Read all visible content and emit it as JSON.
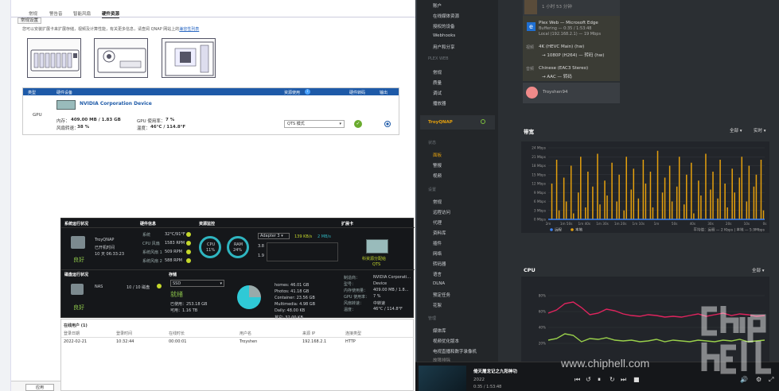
{
  "qnap": {
    "tabs": [
      "常规",
      "警告音",
      "智能风扇",
      "硬件资源"
    ],
    "active_tab": "硬件资源",
    "subtab": "常规设置",
    "description": "您可以安装扩展卡来扩展存储，视频及计算性能，有关更多信息，请查阅 QNAP 网站上的",
    "description_link": "兼容性列表",
    "gpu_table": {
      "headers": [
        "类型",
        "硬件设备",
        "资源使用",
        "硬件转码",
        "输出"
      ],
      "row": {
        "type": "GPU",
        "device_name": "NVIDIA Corporation Device",
        "memory_label": "内存：",
        "memory_value": "409.00 MB / 1.83 GB",
        "gpu_usage_label": "GPU 使用率：",
        "gpu_usage_value": "7 %",
        "fan_label": "风扇转速：",
        "fan_value": "38 %",
        "temp_label": "温度：",
        "temp_value": "46°C / 114.8°F",
        "mode": "QTS 模式"
      }
    },
    "apply_label": "应用"
  },
  "widget": {
    "titles": [
      "系统运行状况",
      "硬件信息",
      "资源监控",
      "扩展卡"
    ],
    "system": {
      "name": "TroyQNAP",
      "uptime_label": "已开机时间",
      "uptime": "10 天 06:33:23",
      "status": "良好"
    },
    "hardware": [
      {
        "label": "系统",
        "value": "32°C/91°F"
      },
      {
        "label": "CPU 风扇",
        "value": "1583 RPM"
      },
      {
        "label": "系统风扇 1",
        "value": "509 RPM"
      },
      {
        "label": "系统风扇 2",
        "value": "588 RPM"
      }
    ],
    "resources": {
      "cpu_label": "CPU",
      "cpu_value": "11%",
      "ram_label": "RAM",
      "ram_value": "24%",
      "adapter": "Adapter 3",
      "rx": "139 KB/s",
      "tx": "2 MB/s",
      "scale": [
        "3.8",
        "1.9"
      ]
    },
    "card": {
      "label": "科资源分配给",
      "label2": "QTS"
    },
    "disk": {
      "title": "磁盘运行状况",
      "label": "NAS",
      "value": "10 / 10 磁盘",
      "status": "良好"
    },
    "storage": {
      "title": "存储",
      "select": "SSD",
      "status": "就绪",
      "used": "已使用：253.18 GB",
      "free": "可用：1.16 TB",
      "folders": [
        "homes: 46.01 GB",
        "Photos: 41.18 GB",
        "Container: 23.56 GB",
        "Multimedia: 4.98 GB",
        "Daily: 48.00 KB",
        "其它: 32.00 KB"
      ]
    },
    "card_info": [
      {
        "label": "制造商：",
        "value": "NVIDIA Corporati..."
      },
      {
        "label": "型号：",
        "value": "Device"
      },
      {
        "label": "内存使用量：",
        "value": "409.00 MB / 1.8..."
      },
      {
        "label": "GPU 使用率：",
        "value": "7 %"
      },
      {
        "label": "风扇转速：",
        "value": "中转速"
      },
      {
        "label": "温度：",
        "value": "46°C / 114.8°F"
      }
    ]
  },
  "users": {
    "title": "在线用户 (1)",
    "headers": [
      "登录日期",
      "登录时间",
      "在线时长",
      "用户名",
      "来源 IP",
      "连接类型"
    ],
    "row": [
      "2022-02-21",
      "10:32:44",
      "00:00:01",
      "Troyshen",
      "192.168.2.1",
      "HTTP"
    ]
  },
  "plex": {
    "sidebar_top": [
      "账户",
      "在线媒体资源",
      "授权的设备",
      "Webhooks",
      "用户和分享"
    ],
    "plex_web_label": "PLEX WEB",
    "plex_web_items": [
      "常规",
      "质量",
      "调试",
      "播放器"
    ],
    "server": "TroyQNAP",
    "status_label": "状态",
    "status_items": [
      "面板",
      "警报",
      "视频"
    ],
    "settings_label": "设置",
    "settings_items": [
      "常规",
      "远程访问",
      "代理",
      "资料库",
      "插件",
      "网络",
      "转码器",
      "语言",
      "DLNA",
      "预定任务",
      "花絮"
    ],
    "manage_label": "管理",
    "manage_items": [
      "媒体库",
      "视频优化版本",
      "电视直播和数字录像机",
      "故障排除"
    ],
    "session": {
      "uptime": "1 小时 53 分钟",
      "client": "Plex Web — Microsoft Edge",
      "buffering": "Buffering — 0:35 / 1:53:48",
      "location": "Local (192.168.2.1) — 19 Mbps",
      "video_label": "视频",
      "video_src": "4K (HEVC Main) (hw)",
      "video_dst": "→ 1080P (H264) — 转码 (hw)",
      "audio_label": "音频",
      "audio_src": "Chinese (EAC3 Stereo)",
      "audio_dst": "→ AAC — 转码",
      "user": "Troyshen94"
    },
    "bandwidth": {
      "title": "带宽",
      "filter": "全部 ▾",
      "mode": "实时 ▾",
      "legend_local": "远程",
      "legend_remote": "本地",
      "summary": "平均值：远程 — 2 Kbps | 本地 — 5.9Mbps"
    },
    "cpu": {
      "title": "CPU",
      "filter": "全部 ▾"
    }
  },
  "chart_data": [
    {
      "type": "bar",
      "title": "带宽",
      "ylabel": "",
      "yticks": [
        "0 Mbps",
        "3 Mbps",
        "6 Mbps",
        "9 Mbps",
        "12 Mbps",
        "15 Mbps",
        "18 Mbps",
        "21 Mbps",
        "24 Mbps"
      ],
      "xticks": [
        "2m",
        "1m 50s",
        "1m 40s",
        "1m 30s",
        "1m 20s",
        "1m 10s",
        "1m",
        "50s",
        "40s",
        "30s",
        "20s",
        "10s",
        "0s"
      ],
      "ylim": [
        0,
        24
      ],
      "series": [
        {
          "name": "本地",
          "color": "#e5a00d",
          "values": [
            0,
            12,
            0,
            20,
            3,
            0,
            14,
            6,
            0,
            18,
            2,
            0,
            9,
            21,
            0,
            4,
            16,
            0,
            11,
            0,
            22,
            5,
            0,
            13,
            8,
            0,
            19,
            0,
            6,
            15,
            0,
            3,
            21,
            0,
            10,
            17,
            0,
            7,
            0,
            20,
            12,
            0,
            16,
            4,
            0,
            23,
            0,
            9,
            14,
            0,
            18,
            6,
            0,
            11,
            21,
            0,
            5,
            15,
            0,
            19,
            2,
            0,
            13,
            8,
            0,
            22,
            0,
            10,
            16,
            0,
            7,
            20,
            0,
            12,
            4,
            0,
            17,
            9,
            0,
            14,
            21,
            0,
            6,
            18,
            0,
            11,
            15,
            0,
            20,
            3
          ]
        },
        {
          "name": "远程",
          "color": "#3b82f6",
          "values": []
        }
      ]
    },
    {
      "type": "line",
      "title": "CPU",
      "yticks": [
        "20%",
        "40%",
        "60%",
        "80%"
      ],
      "ylim": [
        0,
        100
      ],
      "series": [
        {
          "name": "",
          "color": "#e0245e",
          "values": [
            58,
            62,
            70,
            72,
            65,
            56,
            58,
            63,
            61,
            57,
            55,
            54,
            56,
            55,
            53,
            54,
            53,
            55,
            57,
            54,
            56,
            58,
            55,
            57,
            56,
            54,
            55
          ]
        },
        {
          "name": "",
          "color": "#9ad14b",
          "values": [
            24,
            26,
            32,
            30,
            22,
            26,
            25,
            27,
            24,
            23,
            24,
            22,
            23,
            25,
            22,
            24,
            23,
            22,
            24,
            23,
            22,
            24,
            23,
            25,
            22,
            23,
            24
          ]
        }
      ]
    }
  ],
  "player": {
    "title": "倚天屠龙记之九阳神功",
    "year": "2022",
    "time": "0:35 / 1:53:48"
  },
  "watermark": "www.chiphell.com"
}
